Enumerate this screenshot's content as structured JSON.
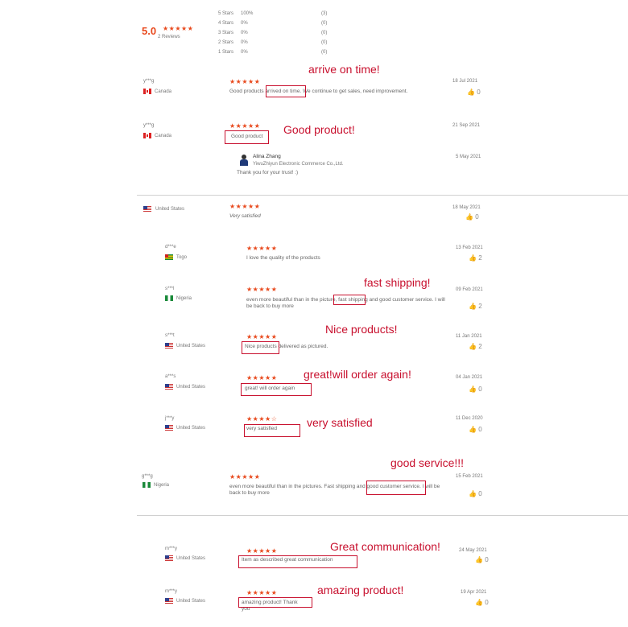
{
  "summary": {
    "rating": "5.0",
    "stars": "★★★★★",
    "count_label": "2 Reviews",
    "breakdown": [
      {
        "label": "5 Stars",
        "pct": "100%",
        "count": "(3)"
      },
      {
        "label": "4 Stars",
        "pct": "0%",
        "count": "(0)"
      },
      {
        "label": "3 Stars",
        "pct": "0%",
        "count": "(0)"
      },
      {
        "label": "2 Stars",
        "pct": "0%",
        "count": "(0)"
      },
      {
        "label": "1 Stars",
        "pct": "0%",
        "count": "(0)"
      }
    ]
  },
  "reviews": [
    {
      "user": "y***g",
      "country": "Canada",
      "stars": "★★★★★",
      "text": "Good products arrived on time. We continue to get sales, need improvement.",
      "date": "18 Jul 2021",
      "likes": "0",
      "annotation": "arrive on time!"
    },
    {
      "user": "y***g",
      "country": "Canada",
      "stars": "★★★★★",
      "text": "Good product",
      "date": "21 Sep 2021",
      "likes": "",
      "annotation": "Good product!",
      "reply": {
        "name": "Alina Zhang",
        "company": "YiwuZhiyun Electronic Commerce Co.,Ltd.",
        "date": "5 May 2021",
        "text": "Thank you for your trust! :)"
      }
    },
    {
      "user": "",
      "country": "United States",
      "stars": "★★★★★",
      "text": "Very satisfied",
      "date": "18 May 2021",
      "likes": "0",
      "annotation": ""
    },
    {
      "user": "d***e",
      "country": "Togo",
      "stars": "★★★★★",
      "text": "I love the quality of the products",
      "date": "13 Feb 2021",
      "likes": "2",
      "annotation": ""
    },
    {
      "user": "s***l",
      "country": "Nigeria",
      "stars": "★★★★★",
      "text": "even more beautiful than in the picture, fast shipping and good customer service. I will be back to buy more",
      "date": "09 Feb 2021",
      "likes": "2",
      "annotation": "fast shipping!"
    },
    {
      "user": "s***t",
      "country": "United States",
      "stars": "★★★★★",
      "text": "Nice products delivered as pictured.",
      "date": "11 Jan 2021",
      "likes": "2",
      "annotation": "Nice products!"
    },
    {
      "user": "a***s",
      "country": "United States",
      "stars": "★★★★★",
      "text": "great! will order again",
      "date": "04 Jan 2021",
      "likes": "0",
      "annotation": "great!will order again!"
    },
    {
      "user": "j***y",
      "country": "United States",
      "stars": "★★★★☆",
      "text": "very satisfied",
      "date": "11 Dec 2020",
      "likes": "0",
      "annotation": "very satisfied"
    },
    {
      "user": "g***g",
      "country": "Nigeria",
      "stars": "★★★★★",
      "text": "even more beautiful than in the pictures. Fast shipping and good customer service. I will be back to buy more",
      "date": "15 Feb 2021",
      "likes": "0",
      "annotation": "good service!!!"
    },
    {
      "user": "m***y",
      "country": "United States",
      "stars": "★★★★★",
      "text": "Item as described great communication",
      "date": "24 May 2021",
      "likes": "0",
      "annotation": "Great communication!"
    },
    {
      "user": "m***y",
      "country": "United States",
      "stars": "★★★★★",
      "text": "amazing product! Thank you",
      "date": "19 Apr 2021",
      "likes": "0",
      "annotation": "amazing product!"
    }
  ],
  "colors": {
    "star": "#e8491d",
    "annotation": "#c8102e"
  }
}
